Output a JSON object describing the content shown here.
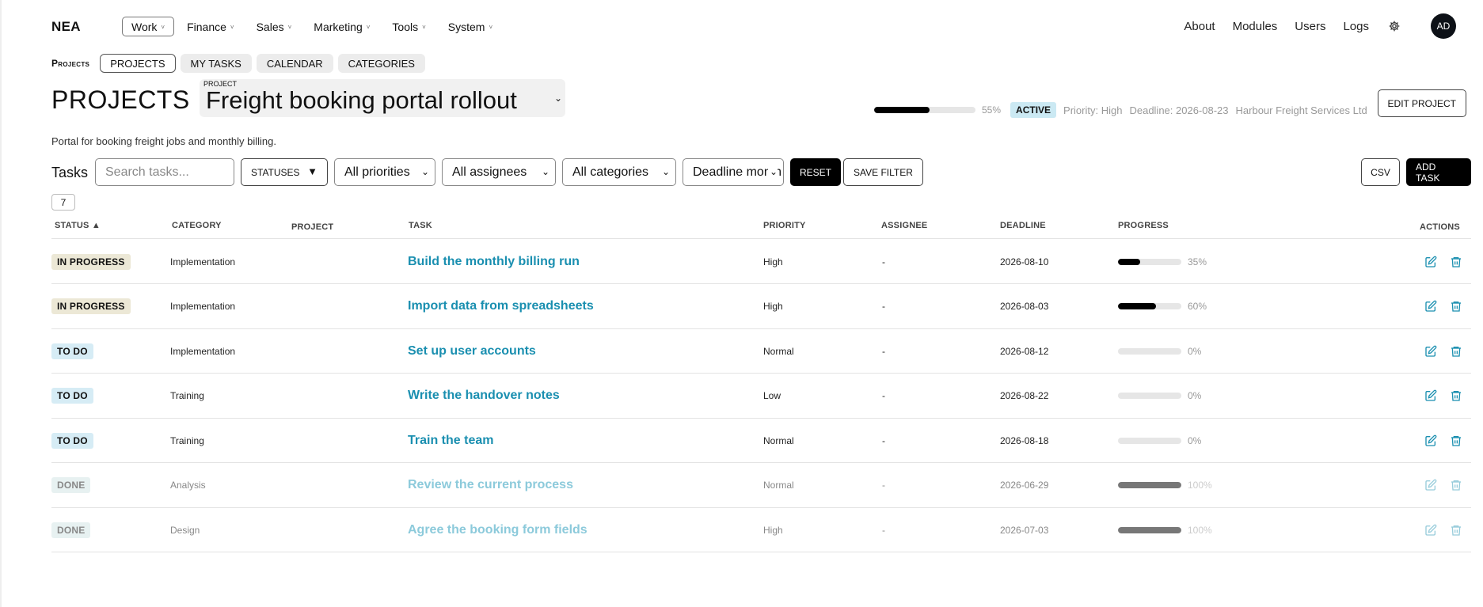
{
  "brand": "NEA",
  "top_menu": [
    {
      "label": "Work",
      "active": true
    },
    {
      "label": "Finance",
      "active": false
    },
    {
      "label": "Sales",
      "active": false
    },
    {
      "label": "Marketing",
      "active": false
    },
    {
      "label": "Tools",
      "active": false
    },
    {
      "label": "System",
      "active": false
    }
  ],
  "top_right": {
    "about": "About",
    "modules": "Modules",
    "users": "Users",
    "logs": "Logs",
    "settings_icon": "gear-icon",
    "avatar": "AD"
  },
  "subnav": {
    "label": "Projects",
    "tabs": [
      {
        "label": "PROJECTS",
        "active": true
      },
      {
        "label": "MY TASKS",
        "active": false
      },
      {
        "label": "CALENDAR",
        "active": false
      },
      {
        "label": "CATEGORIES",
        "active": false
      }
    ]
  },
  "header": {
    "title": "PROJECTS",
    "project_label": "PROJECT",
    "project_name": "Freight booking portal rollout",
    "progress": 55,
    "progress_text": "55%",
    "status": "ACTIVE",
    "priority": "Priority: High",
    "deadline": "Deadline: 2026-08-23",
    "client": "Harbour Freight Services Ltd",
    "edit_button": "EDIT PROJECT",
    "description": "Portal for booking freight jobs and monthly billing."
  },
  "toolbar": {
    "tasks_label": "Tasks",
    "search_placeholder": "Search tasks...",
    "statuses": "STATUSES",
    "priorities": "All priorities",
    "assignees": "All assignees",
    "categories": "All categories",
    "deadline": "Deadline month",
    "reset": "RESET",
    "save_filter": "SAVE FILTER",
    "csv": "CSV",
    "add_task": "ADD TASK",
    "count": "7"
  },
  "table": {
    "headers": {
      "status": "STATUS ▲",
      "category": "CATEGORY",
      "project": "PROJECT",
      "task": "TASK",
      "priority": "PRIORITY",
      "assignee": "ASSIGNEE",
      "deadline": "DEADLINE",
      "progress": "PROGRESS",
      "actions": "ACTIONS"
    },
    "rows": [
      {
        "status": "IN PROGRESS",
        "status_kind": "in-progress",
        "category": "Implementation",
        "project": "",
        "task": "Build the monthly billing run",
        "priority": "High",
        "assignee": "-",
        "deadline": "2026-08-10",
        "progress": 35,
        "progress_text": "35%"
      },
      {
        "status": "IN PROGRESS",
        "status_kind": "in-progress",
        "category": "Implementation",
        "project": "",
        "task": "Import data from spreadsheets",
        "priority": "High",
        "assignee": "-",
        "deadline": "2026-08-03",
        "progress": 60,
        "progress_text": "60%"
      },
      {
        "status": "TO DO",
        "status_kind": "to-do",
        "category": "Implementation",
        "project": "",
        "task": "Set up user accounts",
        "priority": "Normal",
        "assignee": "-",
        "deadline": "2026-08-12",
        "progress": 0,
        "progress_text": "0%"
      },
      {
        "status": "TO DO",
        "status_kind": "to-do",
        "category": "Training",
        "project": "",
        "task": "Write the handover notes",
        "priority": "Low",
        "assignee": "-",
        "deadline": "2026-08-22",
        "progress": 0,
        "progress_text": "0%"
      },
      {
        "status": "TO DO",
        "status_kind": "to-do",
        "category": "Training",
        "project": "",
        "task": "Train the team",
        "priority": "Normal",
        "assignee": "-",
        "deadline": "2026-08-18",
        "progress": 0,
        "progress_text": "0%"
      },
      {
        "status": "DONE",
        "status_kind": "done",
        "category": "Analysis",
        "project": "",
        "task": "Review the current process",
        "priority": "Normal",
        "assignee": "-",
        "deadline": "2026-06-29",
        "progress": 100,
        "progress_text": "100%"
      },
      {
        "status": "DONE",
        "status_kind": "done",
        "category": "Design",
        "project": "",
        "task": "Agree the booking form fields",
        "priority": "High",
        "assignee": "-",
        "deadline": "2026-07-03",
        "progress": 100,
        "progress_text": "100%"
      }
    ]
  },
  "colors": {
    "link": "#1a8fb0",
    "active_badge": "#cbe9f3",
    "in_progress_badge": "#ece8d6",
    "todo_badge": "#d6ecf5"
  }
}
